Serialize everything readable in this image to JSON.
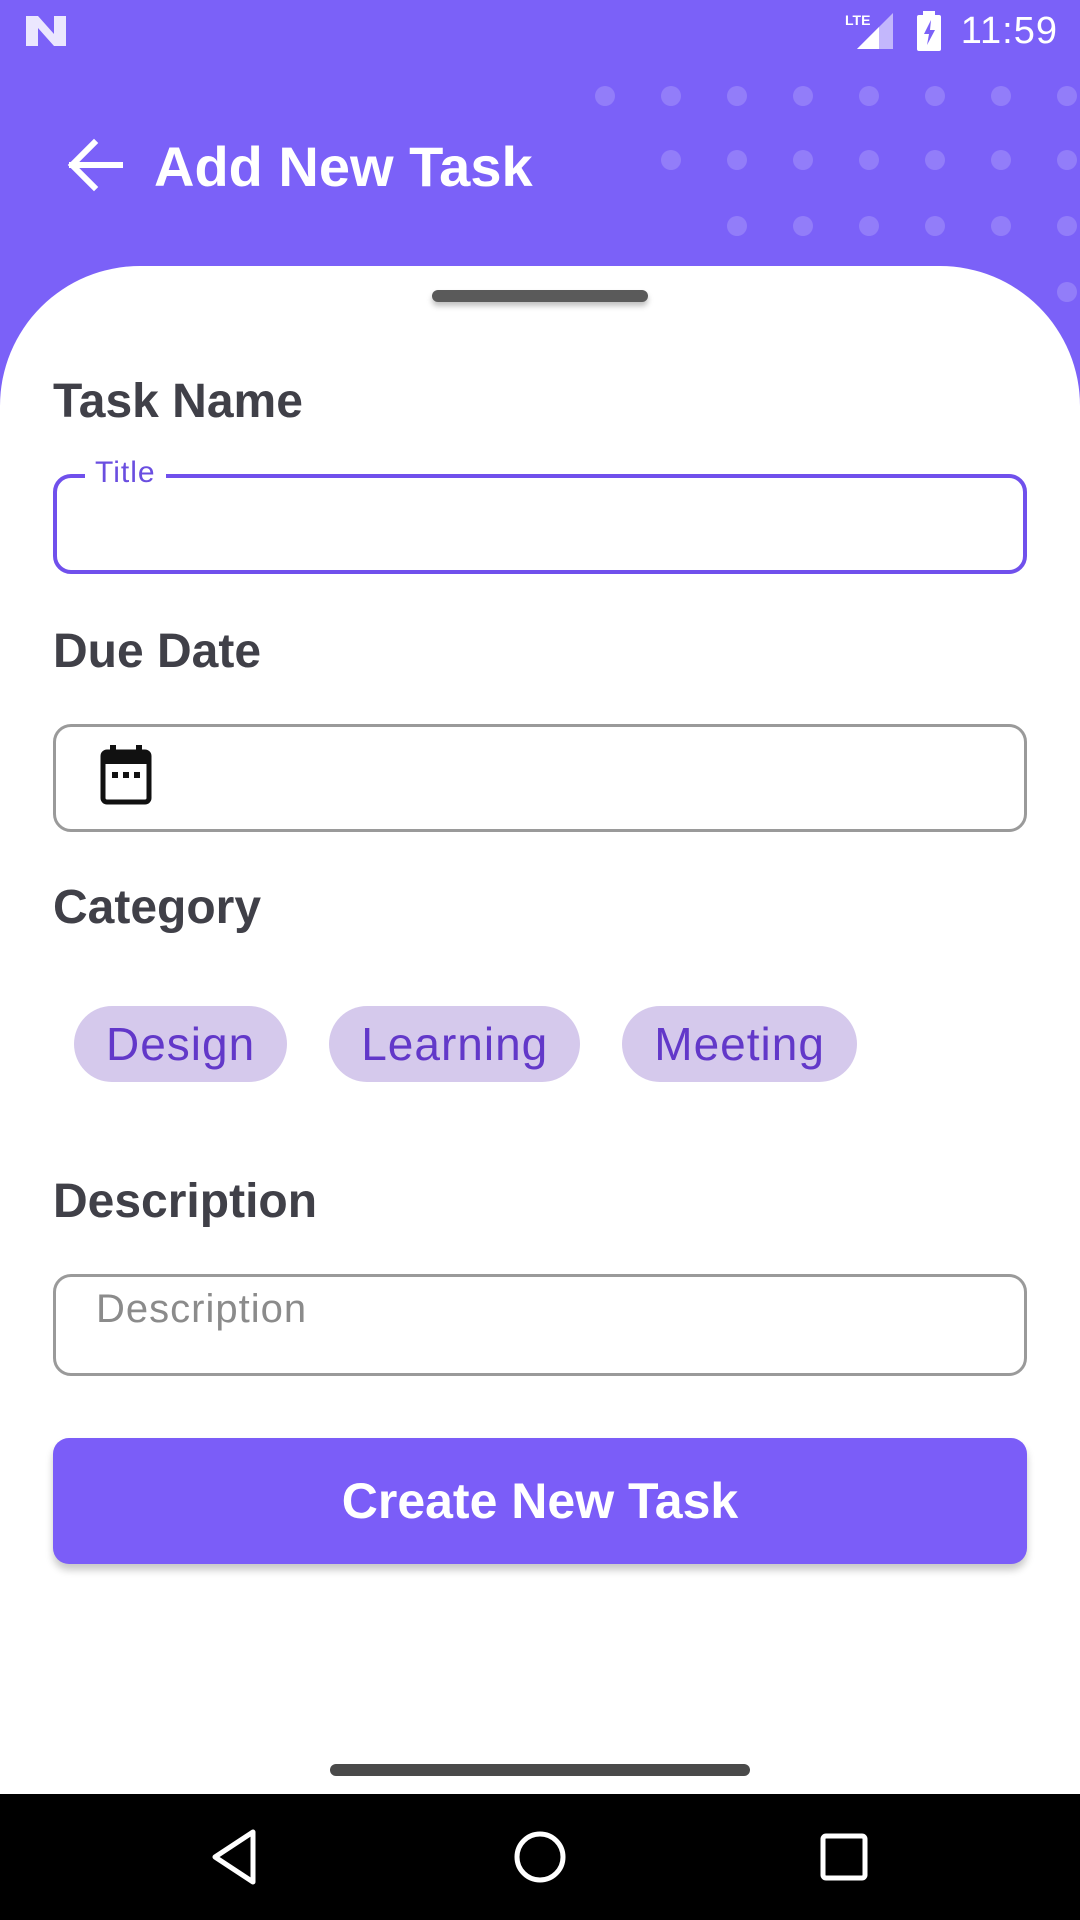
{
  "status_bar": {
    "time": "11:59",
    "network_label": "LTE",
    "icons": [
      "n-logo-icon",
      "lte-signal-icon",
      "battery-charging-icon"
    ]
  },
  "header": {
    "title": "Add New Task",
    "back_icon": "arrow-left-icon"
  },
  "form": {
    "task_name": {
      "label": "Task Name",
      "field_label": "Title",
      "value": ""
    },
    "due_date": {
      "label": "Due Date",
      "icon": "calendar-icon",
      "value": ""
    },
    "category": {
      "label": "Category",
      "chips": [
        "Design",
        "Learning",
        "Meeting"
      ]
    },
    "description": {
      "label": "Description",
      "placeholder": "Description",
      "value": ""
    },
    "submit_label": "Create New Task"
  },
  "colors": {
    "primary": "#7B61F8",
    "chip_bg": "#D5C9EC",
    "chip_text": "#6238C9",
    "label_text": "#404048"
  },
  "nav_bar": {
    "icons": [
      "nav-back-icon",
      "nav-home-icon",
      "nav-recents-icon"
    ]
  }
}
